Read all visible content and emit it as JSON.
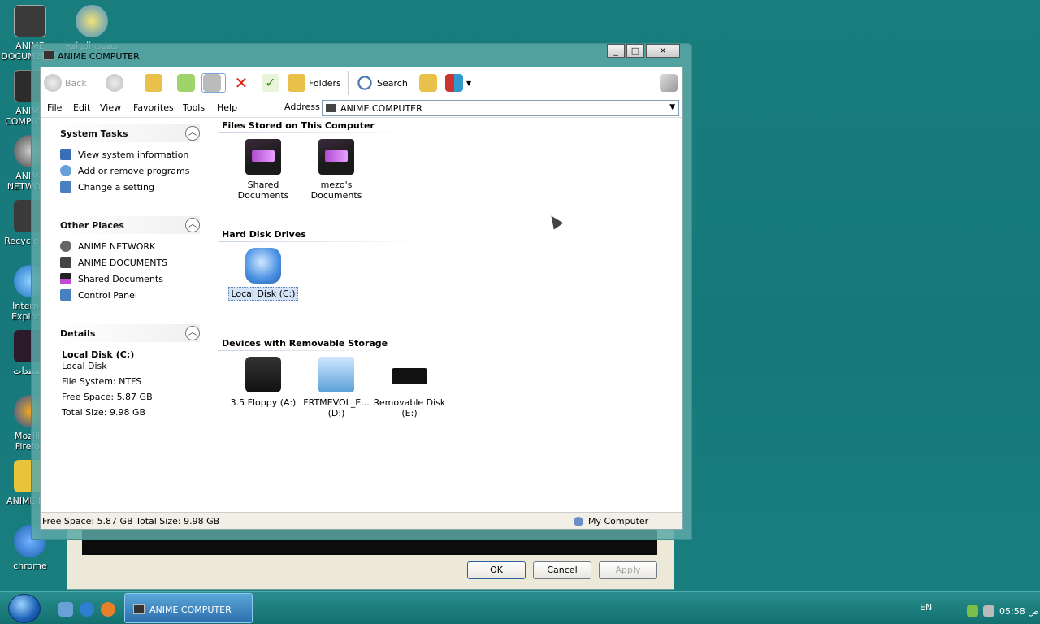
{
  "window": {
    "title": "ANIME COMPUTER",
    "controls": {
      "minimize": "_",
      "maximize": "□",
      "close": "✕"
    }
  },
  "toolbar": {
    "back": "Back",
    "folders": "Folders",
    "search": "Search"
  },
  "menu": [
    "File",
    "Edit",
    "View",
    "Favorites",
    "Tools",
    "Help"
  ],
  "address": {
    "label": "Address",
    "value": "ANIME COMPUTER"
  },
  "left_pane": {
    "system_tasks": {
      "title": "System Tasks",
      "links": [
        "View system information",
        "Add or remove programs",
        "Change a setting"
      ]
    },
    "other_places": {
      "title": "Other Places",
      "links": [
        "ANIME NETWORK",
        "ANIME DOCUMENTS",
        "Shared Documents",
        "Control Panel"
      ]
    },
    "details": {
      "title": "Details",
      "name": "Local Disk (C:)",
      "type": "Local Disk",
      "file_system": "File System: NTFS",
      "free_space": "Free Space: 5.87 GB",
      "total_size": "Total Size: 9.98 GB"
    }
  },
  "content": {
    "groups": [
      {
        "title": "Files Stored on This Computer",
        "items": [
          {
            "label_1": "Shared",
            "label_2": "Documents",
            "icon": "dark-folder-icon"
          },
          {
            "label_1": "mezo's",
            "label_2": "Documents",
            "icon": "dark-folder-icon"
          }
        ]
      },
      {
        "title": "Hard Disk Drives",
        "items": [
          {
            "label_1": "Local Disk (C:)",
            "label_2": "",
            "icon": "hard-disk-icon"
          }
        ]
      },
      {
        "title": "Devices with Removable Storage",
        "items": [
          {
            "label_1": "3.5 Floppy (A:)",
            "label_2": "",
            "icon": "floppy-drive-icon"
          },
          {
            "label_1": "FRTMEVOL_E...",
            "label_2": "(D:)",
            "icon": "cd-drive-icon"
          },
          {
            "label_1": "Removable Disk",
            "label_2": "(E:)",
            "icon": "usb-drive-icon"
          }
        ]
      }
    ]
  },
  "statusbar": {
    "left": "Free Space: 5.87 GB Total Size: 9.98 GB",
    "right": "My Computer"
  },
  "background_dialog": {
    "ok": "OK",
    "cancel": "Cancel",
    "apply": "Apply"
  },
  "desktop_icons": [
    {
      "label": "ANIME DOCUMENTS"
    },
    {
      "label": "تنصيب البرامج"
    },
    {
      "label": "ANIME COMPUTER"
    },
    {
      "label": "ANIME NETWORK"
    },
    {
      "label": "Recycle Bin"
    },
    {
      "label": "Internet Explorer"
    },
    {
      "label": "مستندات"
    },
    {
      "label": "Mozilla Firefox"
    },
    {
      "label": "ANIME D..."
    },
    {
      "label": "chrome"
    }
  ],
  "taskbar": {
    "task": "ANIME COMPUTER",
    "language": "EN",
    "clock": "05:58 ص"
  },
  "colors": {
    "desktop": "#197c7d",
    "taskbar": "#127070",
    "selection": "#d4e3f7"
  }
}
